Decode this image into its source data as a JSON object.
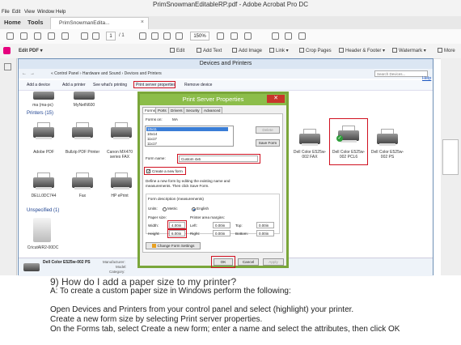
{
  "acrobat": {
    "window_title": "PrimSnowmanEditableRP.pdf - Adobe Acrobat Pro DC",
    "menu": [
      "File",
      "Edit",
      "View",
      "Window",
      "Help"
    ],
    "tabs": {
      "home": "Home",
      "tools": "Tools",
      "document": "PrimSnowmanEdita...",
      "close_glyph": "×"
    },
    "toolbar": {
      "page_current": "1",
      "page_total": "/ 1",
      "zoom": "150%"
    },
    "edit_bar": {
      "label": "Edit PDF ▾",
      "items": [
        "Edit",
        "Add Text",
        "Add Image",
        "Link ▾",
        "Crop Pages",
        "Header & Footer ▾",
        "Watermark ▾",
        "More"
      ]
    }
  },
  "devices_window": {
    "title": "Devices and Printers",
    "address": "« Control Panel › Hardware and Sound › Devices and Printers",
    "search_placeholder": "Search Devices...",
    "commands": [
      "Add a device",
      "Add a printer",
      "See what's printing",
      "Print server properties",
      "Remove device"
    ],
    "help": "Help",
    "top_items": [
      "ma (ma-pc)",
      "MyNetN600"
    ],
    "printers_header": "Printers (15)",
    "printers_row1": [
      "Adobe PDF",
      "Bullzip PDF Printer",
      "Canon MX470 series FAX",
      "Dell Color E525w-002 FAX",
      "Dell Color E525w-002 PCL6",
      "Dell Color E525w-002 PS"
    ],
    "printers_row2": [
      "DELL0DC744",
      "Fax",
      "HP ePrint"
    ],
    "unspecified_header": "Unspecified (1)",
    "unspecified_items": [
      "CricutAIR2-00DC"
    ],
    "status": {
      "name": "Dell Color E525w-002 PS",
      "manufacturer_label": "Manufacturer:",
      "model_label": "Model:",
      "category_label": "Category:"
    }
  },
  "dialog": {
    "title": "Print Server Properties",
    "close_glyph": "✕",
    "tabs": [
      "Forms",
      "Ports",
      "Drivers",
      "Security",
      "Advanced"
    ],
    "forms_on_label": "Forms on:",
    "forms_on_value": "MA",
    "forms_list": [
      "10x11",
      "10x14",
      "11x17",
      "11x17"
    ],
    "delete_label": "Delete",
    "save_form_label": "Save Form",
    "form_name_label": "Form name:",
    "form_name_value": "Custom 4x6",
    "create_checkbox_label": "Create a new form",
    "create_checked_glyph": "✓",
    "create_desc": "Define a new form by editing the existing name and measurements. Then click Save Form.",
    "desc_group": "Form description (measurements)",
    "units_label": "Units:",
    "units_metric": "Metric",
    "units_english": "English",
    "paper_size_label": "Paper size:",
    "margins_label": "Printer area margins:",
    "width_label": "Width:",
    "width_value": "4.00in",
    "height_label": "Height:",
    "height_value": "6.00in",
    "left_label": "Left:",
    "left_value": "0.00in",
    "right_label": "Right:",
    "right_value": "0.00in",
    "top_label": "Top:",
    "top_value": "0.00in",
    "bottom_label": "Bottom:",
    "bottom_value": "0.00in",
    "change_settings_label": "Change Form Settings",
    "ok_label": "OK",
    "cancel_label": "Cancel",
    "apply_label": "Apply"
  },
  "answer": {
    "question": "9) How do I add a paper size to my printer?",
    "lines": [
      "A: To create a custom paper size in Windows perform the following:",
      "Open Devices and Printers from your control panel and select (highlight) your printer.",
      "Create a new form size by selecting Print server properties.",
      "On the Forms tab, select Create a new form; enter a name and select the attributes, then click OK"
    ]
  },
  "colors": {
    "highlight": "#d01020",
    "dialog_frame": "#7aa63a",
    "acrobat_brand": "#d6232a"
  }
}
